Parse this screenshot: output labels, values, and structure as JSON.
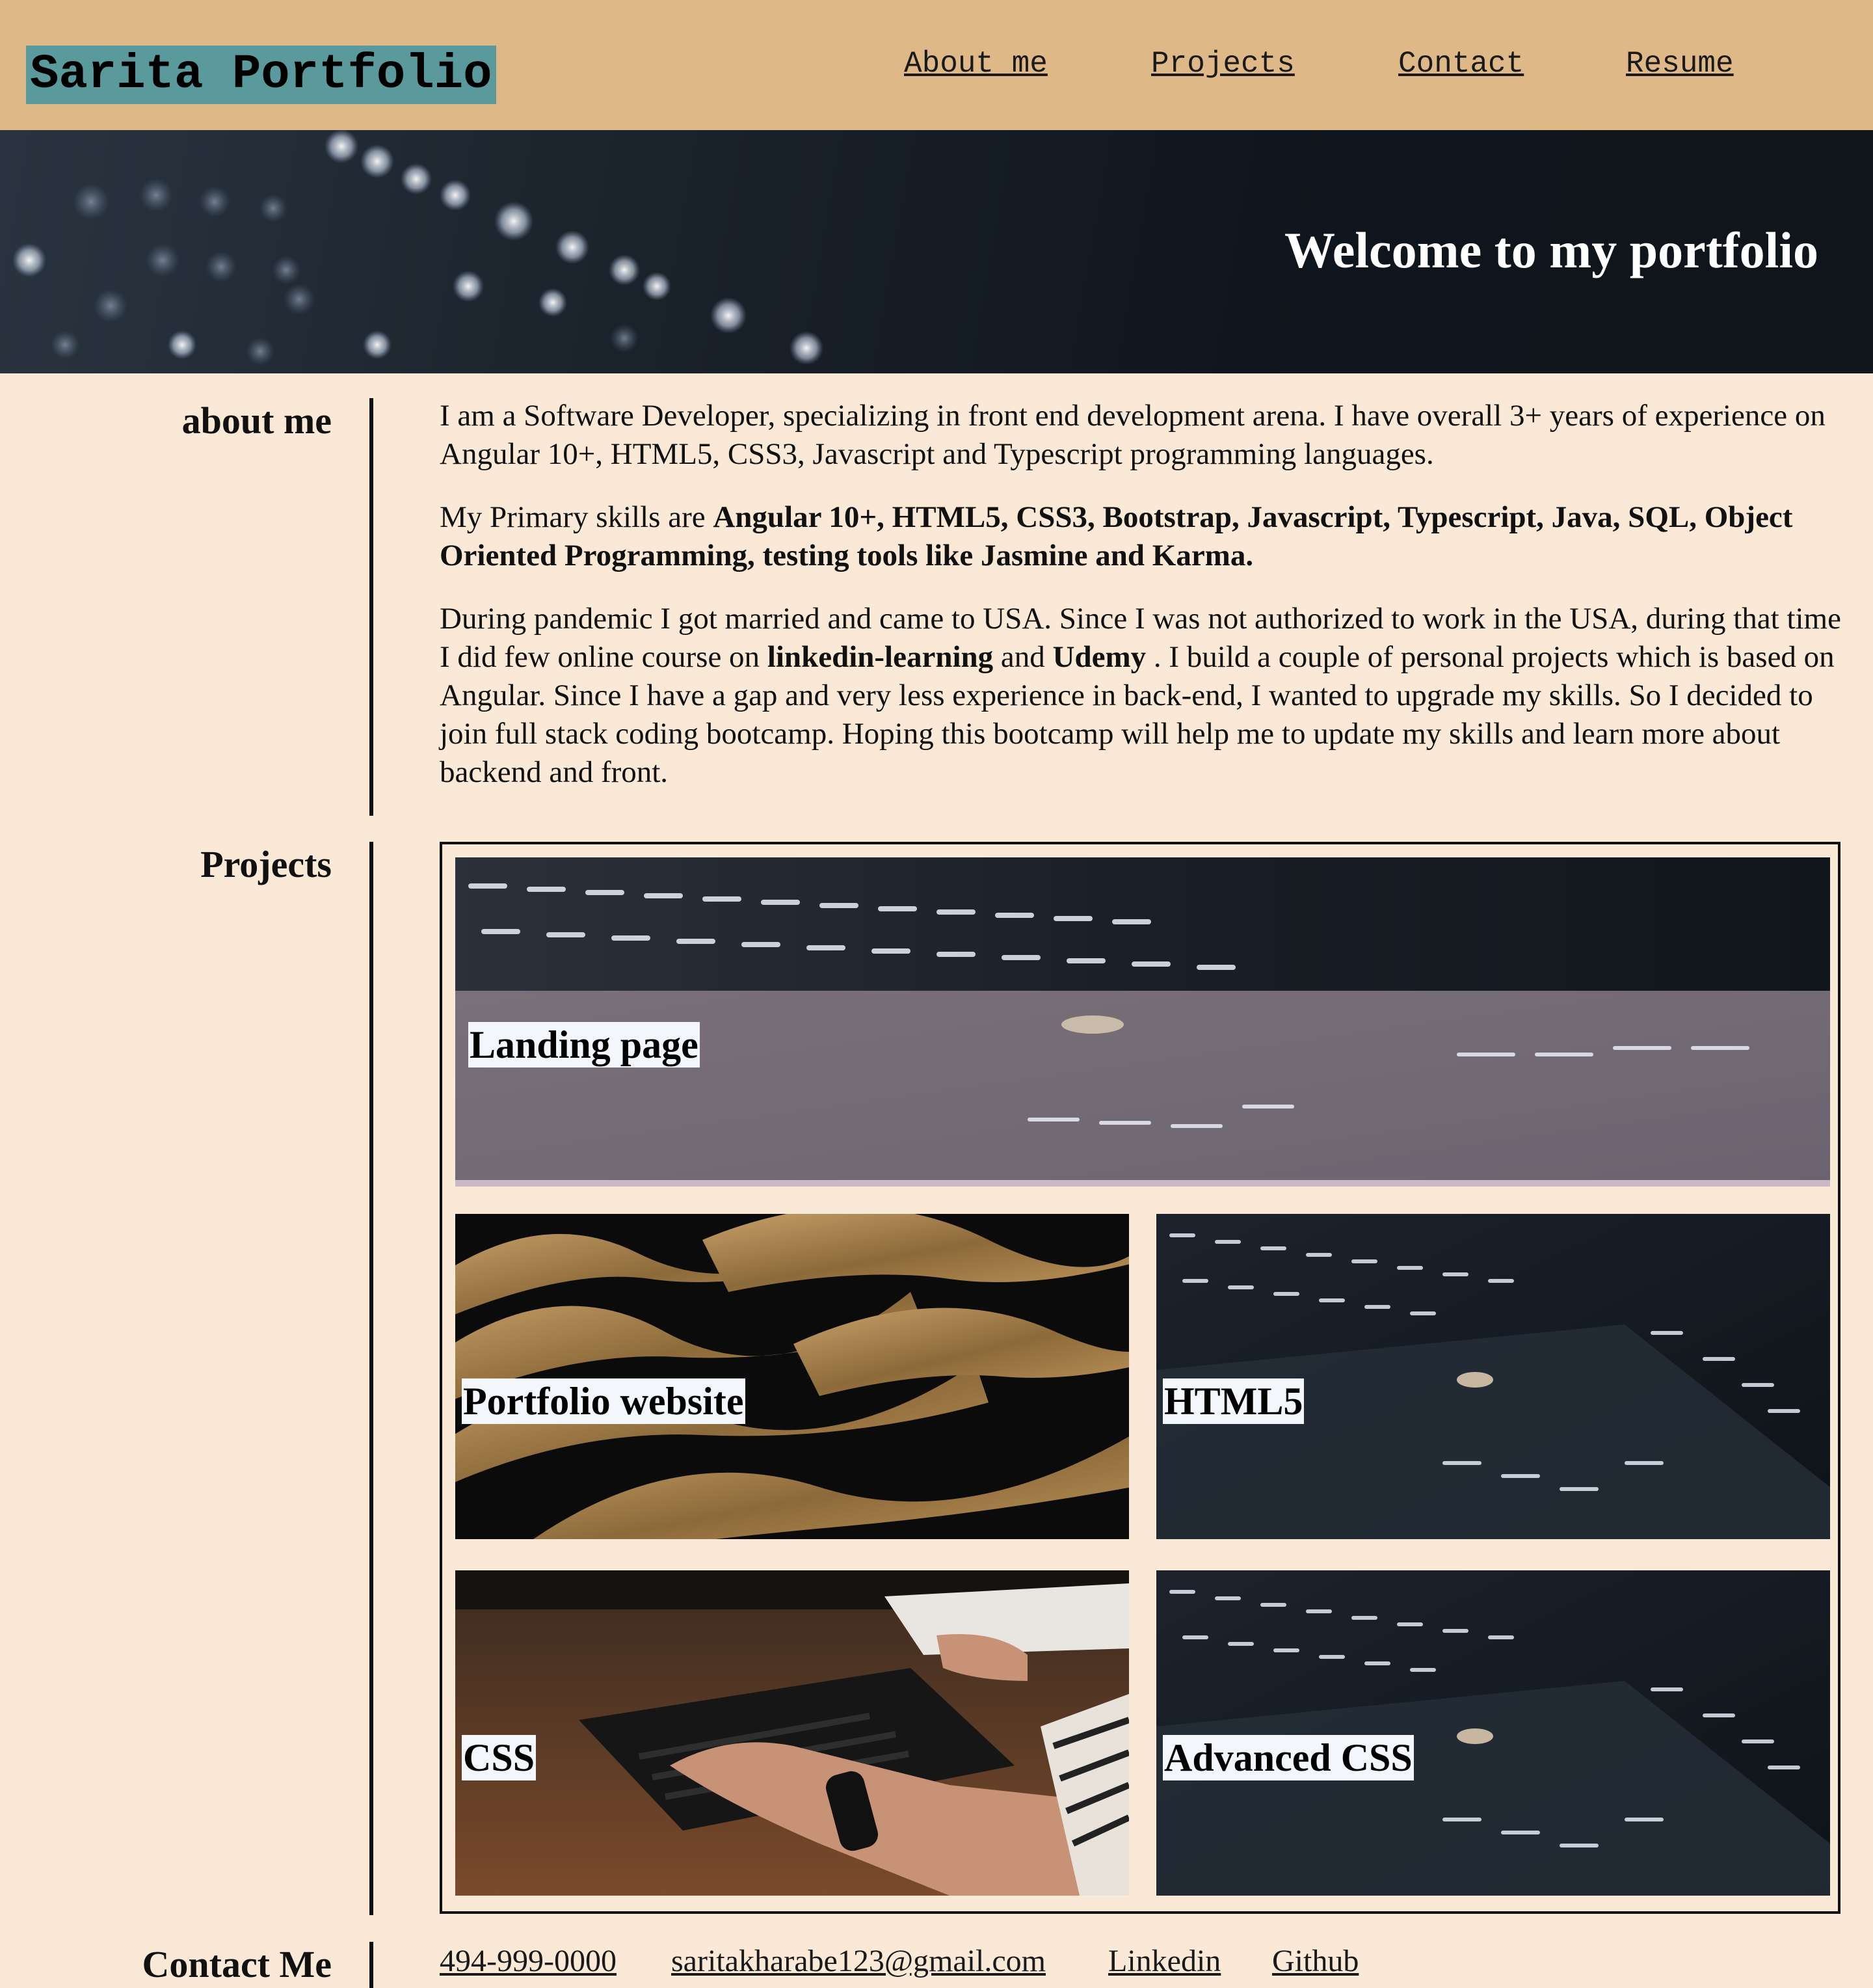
{
  "header": {
    "brand": "Sarita Portfolio",
    "nav": [
      "About me",
      "Projects",
      "Contact",
      "Resume"
    ]
  },
  "hero": {
    "title": "Welcome to my portfolio"
  },
  "about": {
    "heading": "about me",
    "p1": "I am a Software Developer, specializing in front end development arena. I have overall 3+ years of experience on Angular 10+, HTML5, CSS3, Javascript and Typescript programming languages.",
    "p2_prefix": "My Primary skills are ",
    "p2_bold": "Angular 10+, HTML5, CSS3, Bootstrap, Javascript, Typescript, Java, SQL, Object Oriented Programming, testing tools like Jasmine and Karma.",
    "p3_a": "During pandemic I got married and came to USA. Since I was not authorized to work in the USA, during that time I did few online course on ",
    "p3_bold1": "linkedin-learning",
    "p3_b": " and ",
    "p3_bold2": "Udemy",
    "p3_c": " . I build a couple of personal projects which is based on Angular. Since I have a gap and very less experience in back-end, I wanted to upgrade my skills. So I decided to join full stack coding bootcamp. Hoping this bootcamp will help me to update my skills and learn more about backend and front."
  },
  "projects": {
    "heading": "Projects",
    "items": [
      "Landing page",
      "Portfolio website",
      "HTML5",
      "CSS",
      "Advanced CSS"
    ]
  },
  "contact": {
    "heading": "Contact Me",
    "links": [
      "494-999-0000",
      "saritakharabe123@gmail.com",
      "Linkedin",
      "Github"
    ]
  }
}
